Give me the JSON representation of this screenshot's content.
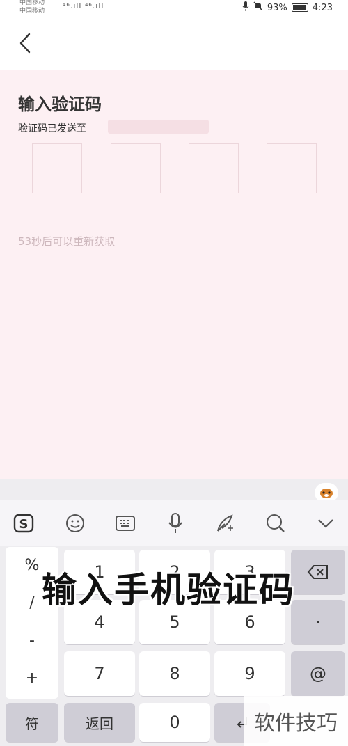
{
  "status_bar": {
    "carrier_1": "中国移动",
    "carrier_2": "中国移动",
    "signal_text": "⁴⁶.ıll ⁴⁶.ıll",
    "battery_percent": "93%",
    "time": "4:23"
  },
  "page": {
    "title": "输入验证码",
    "sent_to_label": "验证码已发送至",
    "resend_countdown": "53秒后可以重新获取",
    "code_boxes": [
      "",
      "",
      "",
      ""
    ]
  },
  "keyboard": {
    "symbols_column": [
      "%",
      "/",
      "-",
      "+"
    ],
    "digits": [
      "1",
      "2",
      "3",
      "4",
      "5",
      "6",
      "7",
      "8",
      "9",
      "0"
    ],
    "dot_label": "·",
    "at_label": "@",
    "symbols_key_label": "符",
    "return_key_label": "返回",
    "toolbar_icons": [
      "sogou-logo-icon",
      "emoji-icon",
      "keyboard-icon",
      "microphone-icon",
      "handwriting-icon",
      "search-icon",
      "collapse-chevron-icon"
    ]
  },
  "overlay_caption": "输入手机验证码",
  "watermark_text": "软件技巧",
  "colors": {
    "page_background": "#fdf0f3",
    "keyboard_background": "#eeedf0"
  }
}
